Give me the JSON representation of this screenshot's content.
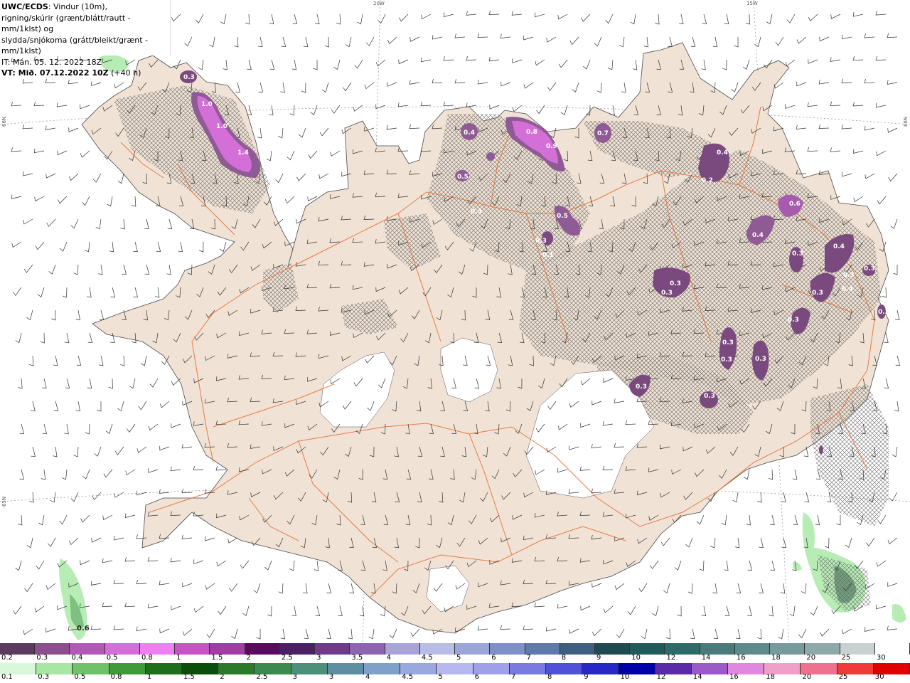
{
  "header": {
    "line1_bold": "UWC/ECDS",
    "line1_rest": ": Vindur (10m),",
    "line2": "rigning/skúrir (grænt/blátt/rautt - mm/1klst) og",
    "line3": "slydda/snjókoma (grátt/bleikt/grænt - mm/1klst)",
    "line4": "IT: Mán. 05. 12. 2022 18Z",
    "line5_bold": "VT: Mið. 07.12.2022 10Z",
    "line5_rest": " (+40 h)"
  },
  "grid_labels": {
    "lon_20w": "20W",
    "lon_15w": "15W",
    "lat_left_upper": "66N",
    "lat_right_upper": "66N",
    "lat_left_lower": "65N"
  },
  "precip_labels": [
    "0.3",
    "1.0",
    "1.0",
    "1.4",
    "0.4",
    "0.5",
    "0.3",
    "0.8",
    "0.9",
    "0.7",
    "0.4",
    "0.2",
    "0.6",
    "0.4",
    "0.5",
    "0.3",
    "0.1",
    "0.3",
    "0.3",
    "0.3",
    "0.3",
    "0.3",
    "0.3",
    "0.3",
    "0.4",
    "0.3",
    "0.4",
    "0.3",
    "0.3",
    "0.3",
    "0.3",
    "0.3",
    "0.6"
  ],
  "snow_scale": {
    "labels": [
      "0.2",
      "0.3",
      "0.4",
      "0.5",
      "0.8",
      "1",
      "1.5",
      "2",
      "2.5",
      "3",
      "3.5",
      "4",
      "4.5",
      "5",
      "6",
      "7",
      "8",
      "9",
      "10",
      "12",
      "14",
      "16",
      "18",
      "20",
      "25",
      "30"
    ],
    "colors": [
      "#5b3a5e",
      "#8a4f8c",
      "#b15ab5",
      "#d46fd8",
      "#f07ef3",
      "#c853c9",
      "#a13da3",
      "#5a0a5c",
      "#4b1f63",
      "#6e3a8a",
      "#8e63b0",
      "#a9a3d8",
      "#b8bde8",
      "#9aa6d8",
      "#7f8fc8",
      "#5f7aa8",
      "#3e5f7f",
      "#1f4a4f",
      "#205a5a",
      "#2f6a6a",
      "#4a7a7a",
      "#5f8a8a",
      "#789a9a",
      "#8fa8a8",
      "#c9d0d0",
      "#ffffff"
    ]
  },
  "rain_scale": {
    "labels": [
      "0.1",
      "0.3",
      "0.5",
      "0.8",
      "1",
      "1.5",
      "2",
      "2.5",
      "3",
      "3",
      "4",
      "4.5",
      "5",
      "6",
      "7",
      "8",
      "9",
      "10",
      "12",
      "14",
      "16",
      "18",
      "20",
      "25",
      "30"
    ],
    "colors": [
      "#d9f7d9",
      "#a8e6a4",
      "#6fc26a",
      "#3f9a3b",
      "#1e6e1b",
      "#0b4d0a",
      "#2a7a2a",
      "#3c8a4e",
      "#4e8f7a",
      "#5e8fa0",
      "#7fa0c8",
      "#9aa8e0",
      "#b8b8f0",
      "#a0a0e8",
      "#7a7ae0",
      "#5050d8",
      "#2828c8",
      "#0000a8",
      "#5a2aa8",
      "#9a5ac8",
      "#e088e0",
      "#f0a0c8",
      "#f07090",
      "#f03a3a",
      "#e00000"
    ]
  }
}
